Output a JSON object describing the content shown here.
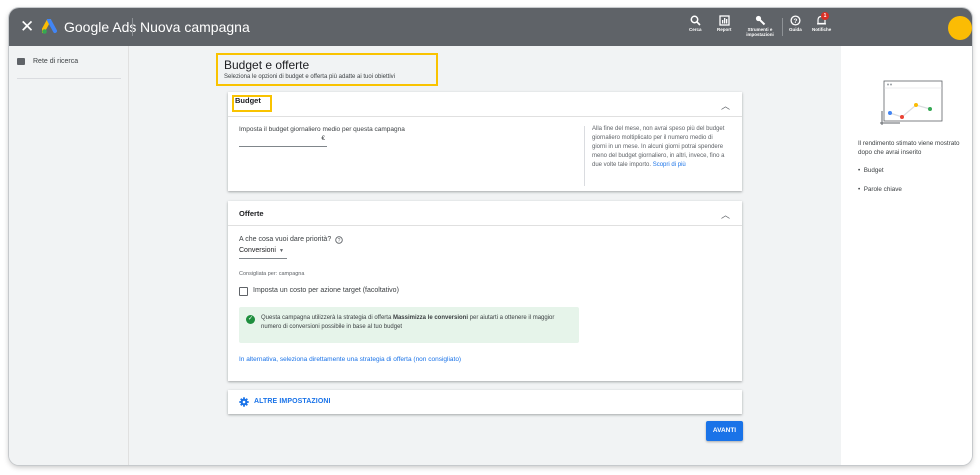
{
  "topbar": {
    "close_icon": "close-icon",
    "brand": "Google Ads",
    "campaign_title": "Nuova campagna",
    "tools": [
      {
        "icon": "search-icon",
        "label": "Cerca"
      },
      {
        "icon": "report-icon",
        "label": "Report"
      },
      {
        "icon": "wrench-icon",
        "label": "Strumenti e impostazioni"
      },
      {
        "icon": "help-icon",
        "label": "Guida"
      },
      {
        "icon": "bell-icon",
        "label": "Notifiche"
      }
    ],
    "notification_count": "1",
    "avatar_color": "#fbbc04"
  },
  "leftnav": {
    "items": [
      {
        "icon": "network-icon",
        "label": "Rete di ricerca"
      }
    ]
  },
  "header": {
    "title": "Budget e offerte",
    "subtitle": "Seleziona le opzioni di budget e offerta più adatte ai tuoi obiettivi"
  },
  "budget": {
    "title": "Budget",
    "field_label": "Imposta il budget giornaliero medio per questa campagna",
    "currency": "€",
    "help_text": "Alla fine del mese, non avrai speso più del budget giornaliero moltiplicato per il numero medio di giorni in un mese. In alcuni giorni potrai spendere meno del budget giornaliero, in altri, invece, fino a due volte tale importo.",
    "learn_more": "Scopri di più"
  },
  "bids": {
    "title": "Offerte",
    "question": "A che cosa vuoi dare priorità?",
    "selected": "Conversioni",
    "recommended_for": "Consigliata per: campagna",
    "cpa_checkbox": "Imposta un costo per azione target (facoltativo)",
    "info_prefix": "Questa campagna utilizzerà la strategia di offerta ",
    "info_strategy": "Massimizza le conversioni",
    "info_suffix": " per aiutarti a ottenere il maggior numero di conversioni possibile in base al tuo budget",
    "alt_link": "In alternativa, seleziona direttamente una strategia di offerta (non consigliato)"
  },
  "more_settings": {
    "label": "ALTRE IMPOSTAZIONI",
    "icon": "gear-icon"
  },
  "next_button": "AVANTI",
  "right_panel": {
    "text": "Il rendimento stimato viene mostrato dopo che avrai inserito",
    "bullets": [
      "Budget",
      "Parole chiave"
    ]
  },
  "colors": {
    "topbar": "#5f6368",
    "accent": "#1a73e8",
    "highlight": "#f9c300",
    "success_bg": "#e6f4ea",
    "success_icon": "#1e8e3e"
  }
}
